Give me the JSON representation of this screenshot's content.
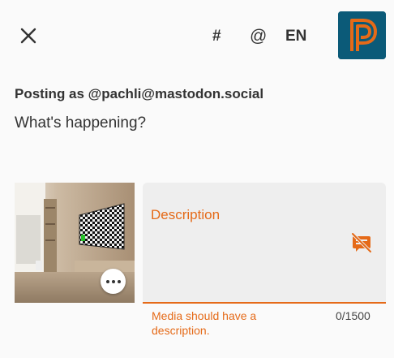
{
  "toolbar": {
    "hashtag_label": "#",
    "mention_label": "@",
    "language_label": "EN"
  },
  "avatar": {
    "letter": "P"
  },
  "compose": {
    "posting_as": "Posting as @pachli@mastodon.social",
    "placeholder": "What's happening?"
  },
  "media": {
    "description_label": "Description",
    "helper_text": "Media should have a description.",
    "counter": "0/1500"
  },
  "colors": {
    "accent": "#e56a18",
    "avatar_bg": "#0b5a78",
    "field_bg": "#eeeeee",
    "background": "#fafafa"
  }
}
